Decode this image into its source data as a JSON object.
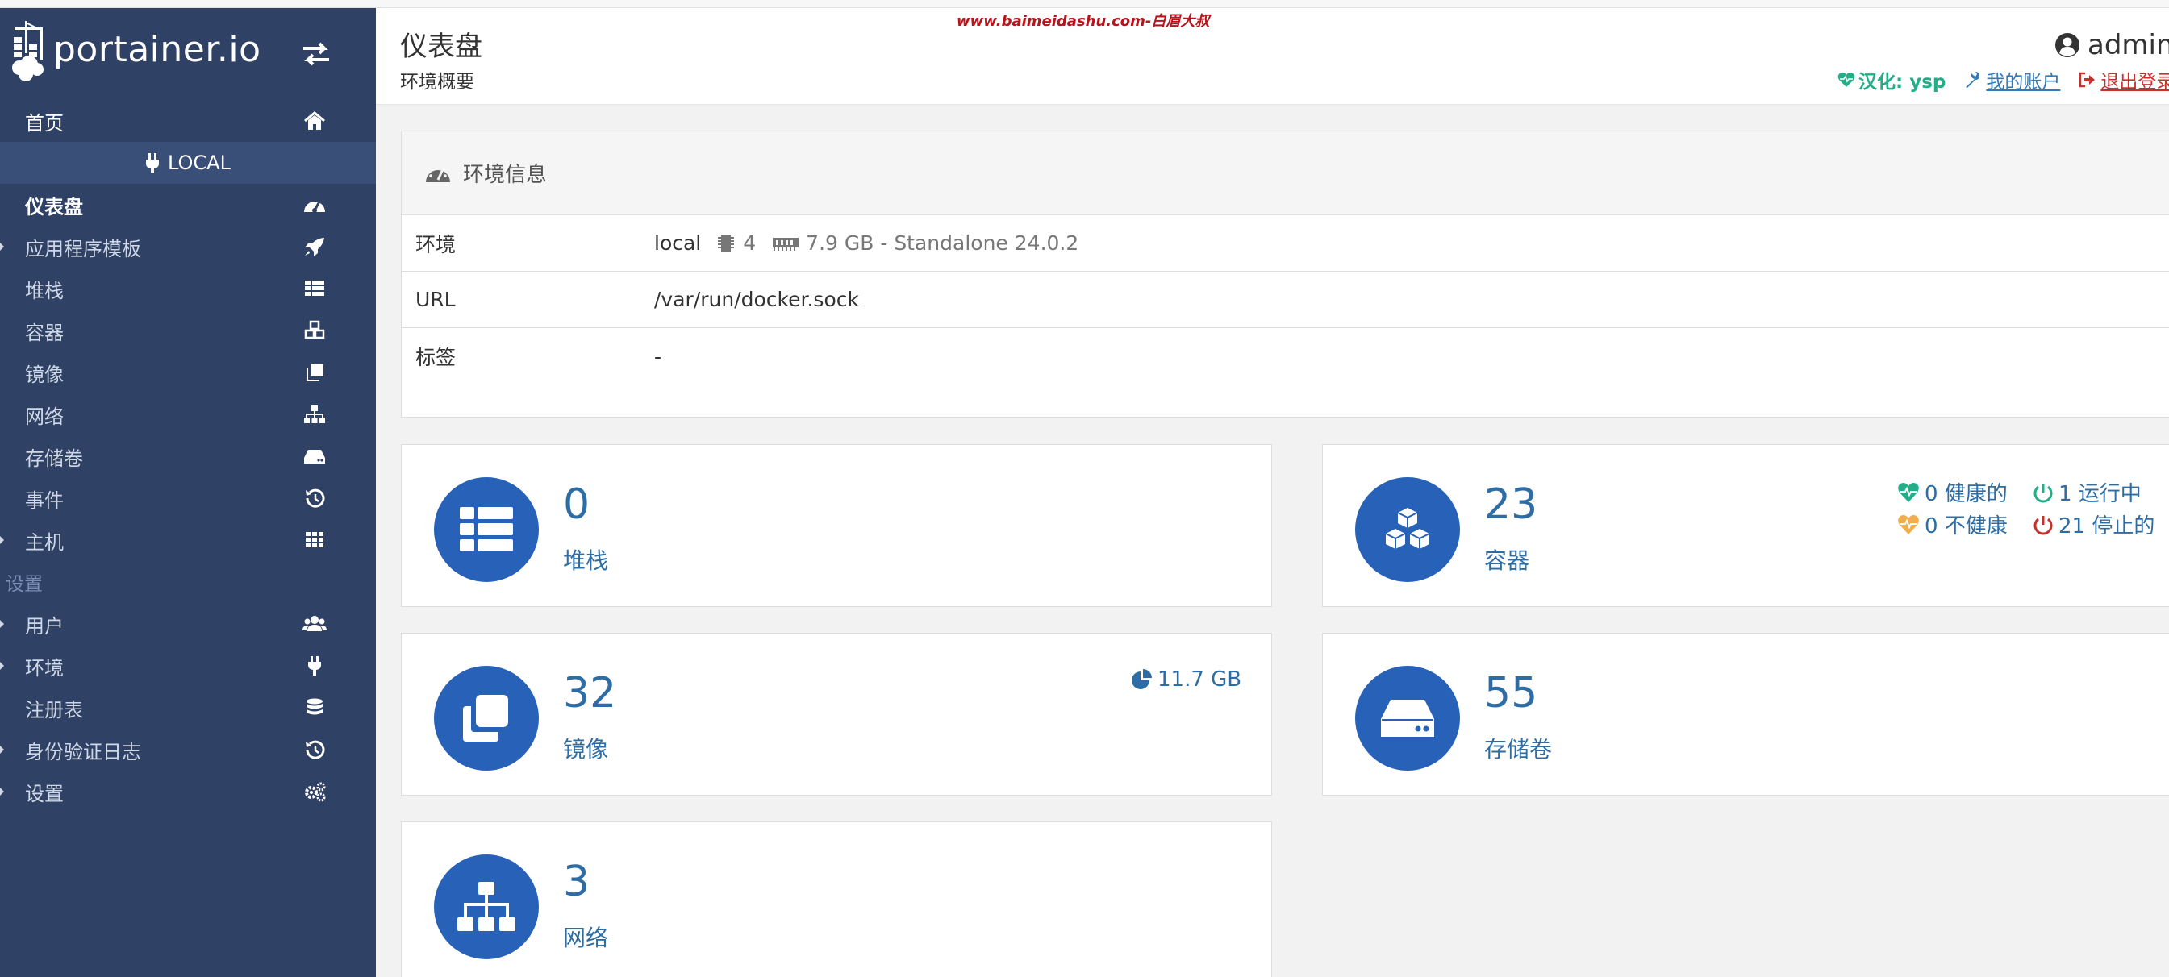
{
  "brand": {
    "name": "portainer.io"
  },
  "watermark": "www.baimeidashu.com-白眉大叔",
  "sidebar": {
    "home": "首页",
    "endpoint": "LOCAL",
    "items": [
      {
        "label": "仪表盘",
        "icon": "tachometer-icon"
      },
      {
        "label": "应用程序模板",
        "icon": "rocket-icon"
      },
      {
        "label": "堆栈",
        "icon": "th-list-icon"
      },
      {
        "label": "容器",
        "icon": "cubes-icon"
      },
      {
        "label": "镜像",
        "icon": "clone-icon"
      },
      {
        "label": "网络",
        "icon": "sitemap-icon"
      },
      {
        "label": "存储卷",
        "icon": "hdd-icon"
      },
      {
        "label": "事件",
        "icon": "history-icon"
      },
      {
        "label": "主机",
        "icon": "th-icon"
      }
    ],
    "settings_title": "设置",
    "settings_items": [
      {
        "label": "用户",
        "icon": "users-icon"
      },
      {
        "label": "环境",
        "icon": "plug-icon"
      },
      {
        "label": "注册表",
        "icon": "database-icon"
      },
      {
        "label": "身份验证日志",
        "icon": "history-icon"
      },
      {
        "label": "设置",
        "icon": "cogs-icon"
      }
    ]
  },
  "header": {
    "title": "仪表盘",
    "subtitle": "环境概要",
    "user": "admin",
    "links": {
      "translation": "汉化: ysp",
      "account": "我的账户",
      "logout": "退出登录"
    }
  },
  "env_panel": {
    "title": "环境信息",
    "rows": {
      "env_label": "环境",
      "env_name": "local",
      "cpu": "4",
      "memory_info": "7.9 GB - Standalone 24.0.2",
      "url_label": "URL",
      "url_value": "/var/run/docker.sock",
      "tags_label": "标签",
      "tags_value": "-"
    }
  },
  "widgets": {
    "stacks": {
      "value": "0",
      "title": "堆栈"
    },
    "containers": {
      "value": "23",
      "title": "容器",
      "healthy": "0 健康的",
      "running": "1 运行中",
      "unhealthy": "0 不健康",
      "stopped": "21 停止的"
    },
    "images": {
      "value": "32",
      "title": "镜像",
      "size": "11.7 GB"
    },
    "volumes": {
      "value": "55",
      "title": "存储卷"
    },
    "networks": {
      "value": "3",
      "title": "网络"
    }
  },
  "colors": {
    "sidebar": "#2f4165",
    "accent": "#2861b8",
    "value_text": "#2e6da4",
    "green": "#23ae89",
    "orange": "#f0ad4e",
    "red": "#c9302c"
  }
}
